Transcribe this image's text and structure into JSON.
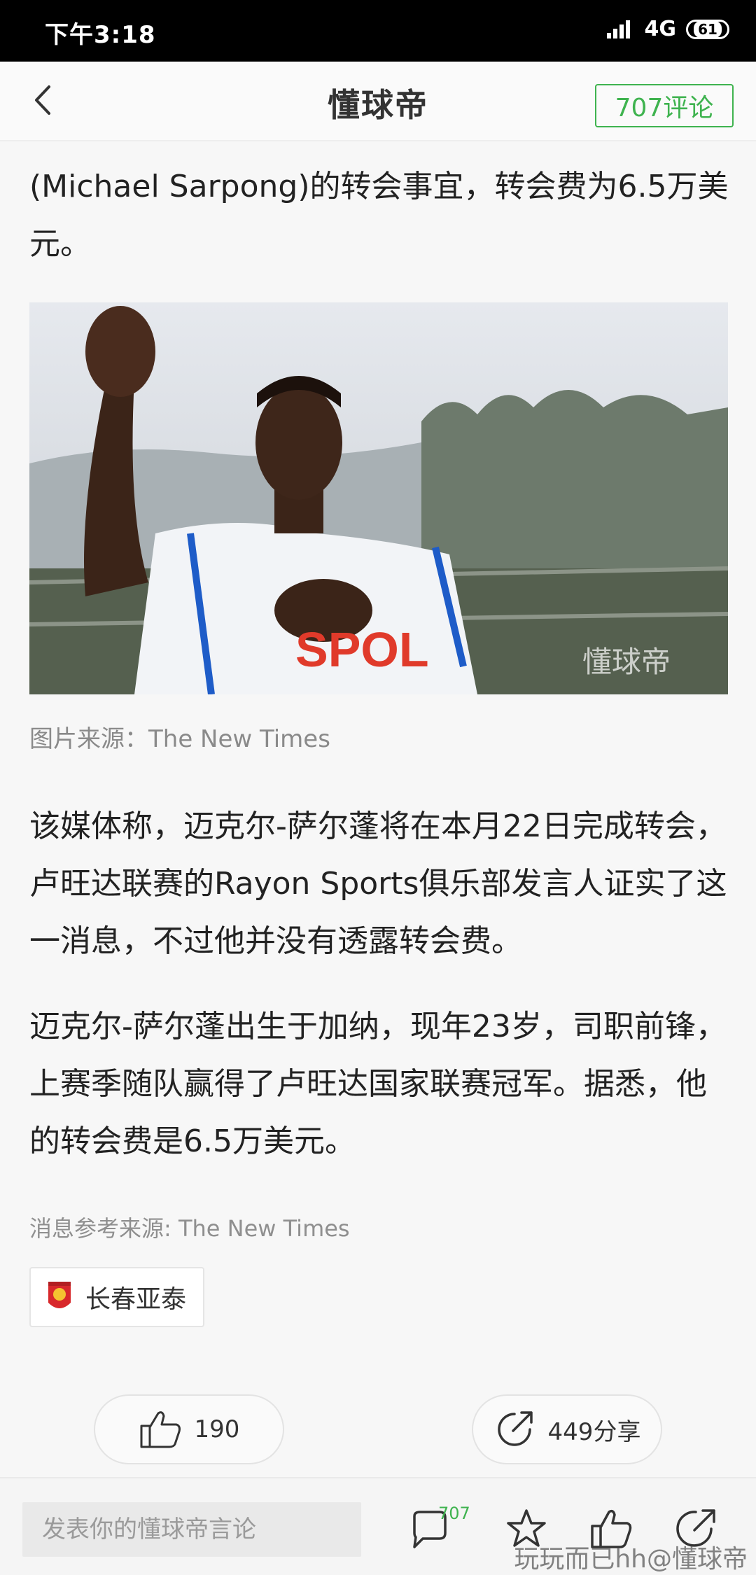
{
  "status_bar": {
    "time": "下午3:18",
    "network": "4G",
    "battery": "61"
  },
  "header": {
    "title": "懂球帝",
    "comments_button": "707评论"
  },
  "article": {
    "para1": "(Michael Sarpong)的转会事宜，转会费为6.5万美元。",
    "photo_watermark": "懂球帝",
    "photo_caption": "图片来源：The New Times",
    "para2": "该媒体称，迈克尔-萨尔蓬将在本月22日完成转会，卢旺达联赛的Rayon Sports俱乐部发言人证实了这一消息，不过他并没有透露转会费。",
    "para3": "迈克尔-萨尔蓬出生于加纳，现年23岁，司职前锋，上赛季随队赢得了卢旺达国家联赛冠军。据悉，他的转会费是6.5万美元。",
    "source_note": "消息参考来源: The New Times",
    "tag_label": "长春亚泰"
  },
  "actions": {
    "like_count": "190",
    "share_label": "449分享"
  },
  "bottom_bar": {
    "input_placeholder": "发表你的懂球帝言论",
    "comment_badge": "707",
    "watermark": "玩玩而已hh@懂球帝"
  },
  "colors": {
    "accent": "#3fb34f",
    "text": "#222222",
    "muted": "#8a8a8a"
  },
  "icons": [
    "back-arrow-icon",
    "thumb-up-icon",
    "share-icon",
    "comment-bubble-icon",
    "star-icon",
    "team-logo-icon"
  ]
}
